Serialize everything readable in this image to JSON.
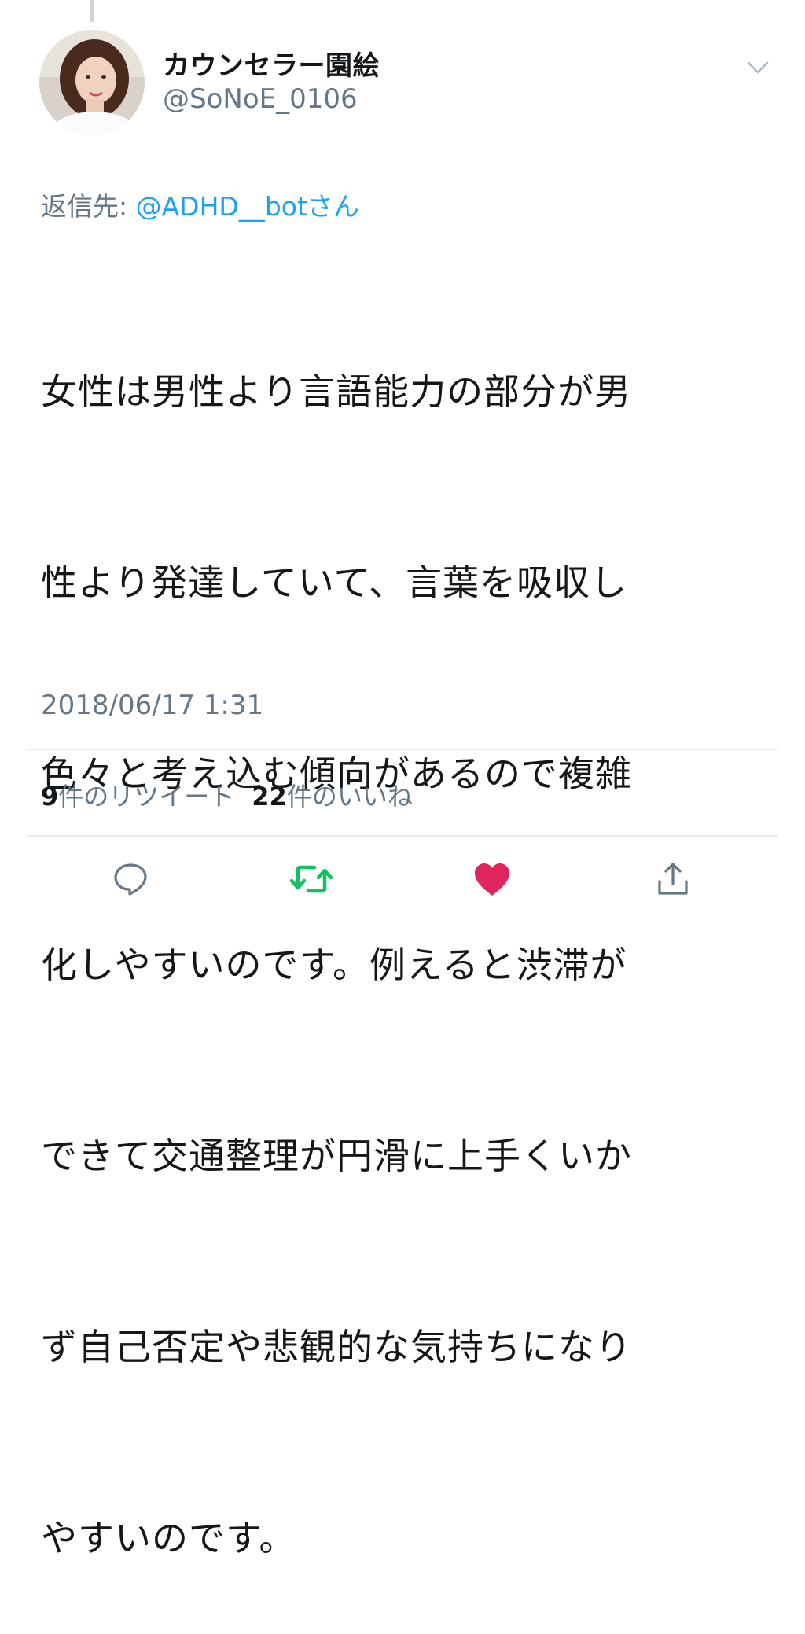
{
  "author": {
    "display_name": "カウンセラー園絵",
    "handle": "@SoNoE_0106"
  },
  "reply": {
    "prefix": "返信先: ",
    "target": "@ADHD__botさん"
  },
  "tweet": {
    "lines": [
      "女性は男性より言語能力の部分が男",
      "性より発達していて、言葉を吸収し",
      "色々と考え込む傾向があるので複雑",
      "化しやすいのです。例えると渋滞が",
      "できて交通整理が円滑に上手くいか",
      "ず自己否定や悲観的な気持ちになり",
      "やすいのです。"
    ],
    "timestamp": "2018/06/17 1:31"
  },
  "stats": {
    "retweets_count": "9",
    "retweets_label": "件のリツイート",
    "likes_count": "22",
    "likes_label": "件のいいね"
  },
  "icons": {
    "reply": "reply-bubble-icon",
    "retweet": "retweet-arrows-icon",
    "like": "heart-icon",
    "share": "share-upload-icon",
    "menu": "chevron-down-icon"
  },
  "colors": {
    "link": "#1da1f2",
    "muted": "#657786",
    "retweeted": "#17bf63",
    "liked": "#e0245e"
  }
}
